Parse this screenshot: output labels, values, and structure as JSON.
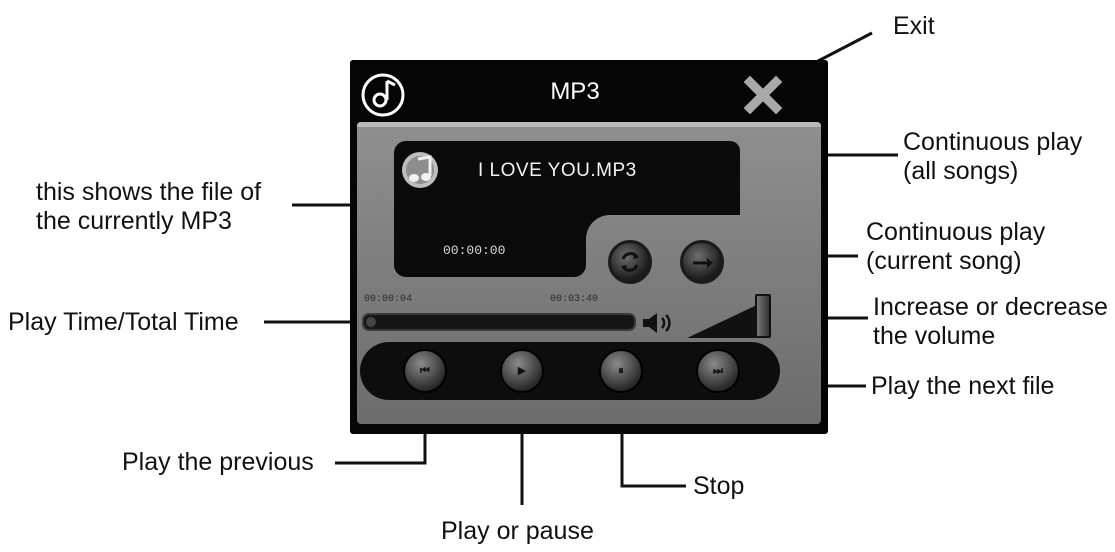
{
  "player": {
    "title": "MP3",
    "track_name": "I LOVE YOU.MP3",
    "elapsed": "00:00:00",
    "time_start": "00:00:04",
    "time_total": "00:03:40",
    "progress_fraction": 0.02,
    "volume_fraction": 1.0
  },
  "icons": {
    "logo": "music-disc-icon",
    "exit": "close-icon",
    "track": "music-note-icon",
    "repeat_all": "repeat-icon",
    "repeat_one": "single-repeat-icon",
    "volume": "speaker-icon",
    "previous": "previous-icon",
    "play": "play-icon",
    "pause": "pause-icon",
    "next": "next-icon"
  },
  "transport": {
    "previous_glyph": "⏮",
    "play_glyph": "▶",
    "pause_glyph": "⏸",
    "next_glyph": "⏭"
  },
  "callouts": {
    "exit": "Exit",
    "file_line1": "this shows the file of",
    "file_line2": "the currently MP3",
    "repeat_all_line1": "Continuous play",
    "repeat_all_line2": "(all songs)",
    "repeat_one_line1": "Continuous play",
    "repeat_one_line2": "(current song)",
    "play_time": "Play Time/Total Time",
    "volume_line1": "Increase or decrease",
    "volume_line2": "the volume",
    "next": "Play the next file",
    "previous": "Play the previous",
    "stop": "Stop",
    "play_pause": "Play or pause"
  }
}
